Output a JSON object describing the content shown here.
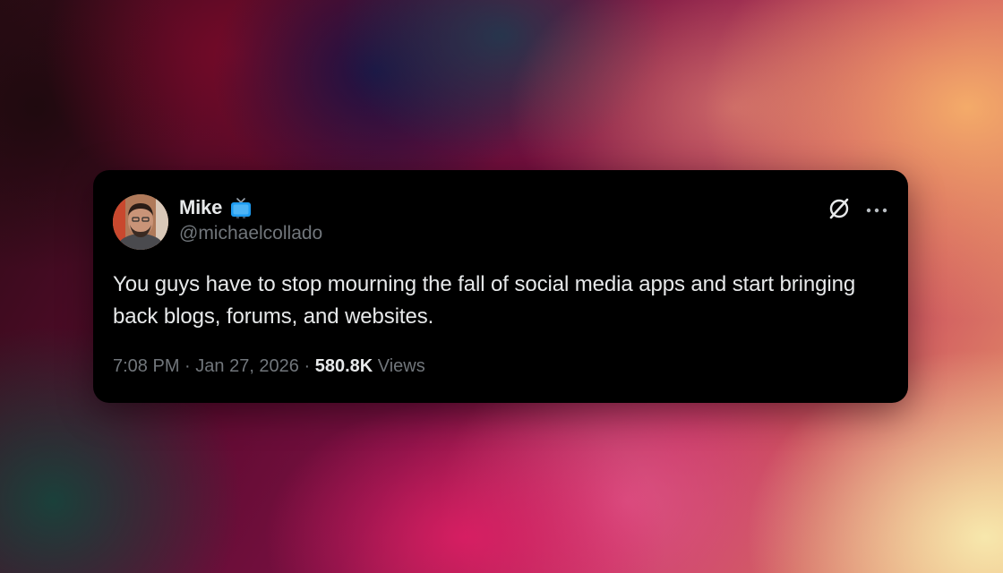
{
  "post": {
    "author": {
      "display_name": "Mike",
      "handle": "@michaelcollado",
      "badge_icon": "tv-icon"
    },
    "text": "You guys have to stop mourning the fall of social media apps and start bringing back blogs, forums, and websites.",
    "time": "7:08 PM",
    "separator": " · ",
    "date": "Jan 27, 2026",
    "views_count": "580.8K",
    "views_label": " Views"
  },
  "actions": {
    "logo_icon": "x-logo-icon",
    "more_icon": "more-icon"
  },
  "colors": {
    "card_background": "#000000",
    "primary_text": "#e7e9ea",
    "secondary_text": "#71767b",
    "badge_blue": "#1d9bf0"
  }
}
